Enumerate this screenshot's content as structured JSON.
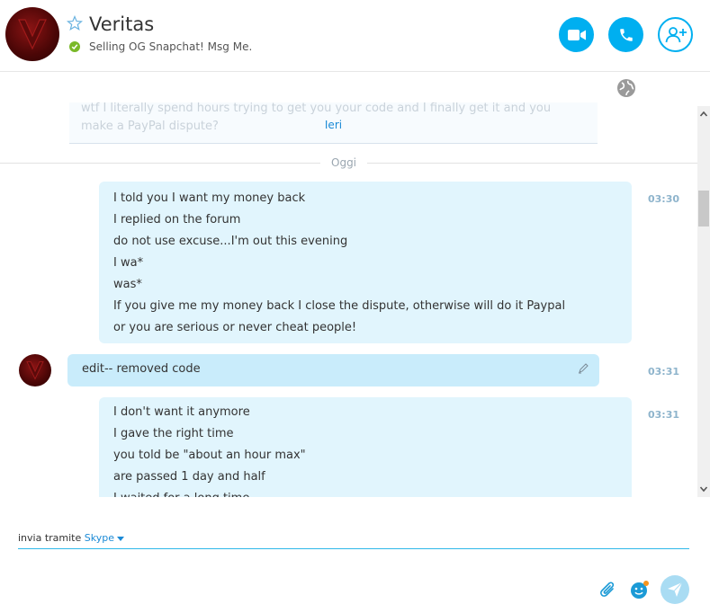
{
  "header": {
    "contact_name": "Veritas",
    "mood_message": "Selling OG Snapchat! Msg Me.",
    "status": "online",
    "buttons": [
      "video-call",
      "audio-call",
      "add-people"
    ]
  },
  "conversation": {
    "yesterday_preview": "wtf I literally spend hours trying to get you your code and I finally get it and you make a PayPal dispute?",
    "yesterday_label": "Ieri",
    "today_label": "Oggi",
    "messages": [
      {
        "sender": "me",
        "time": "03:30",
        "lines": [
          "I told you I want my money back",
          "I replied on the forum",
          "do not use excuse...I'm out this evening",
          "I wa*",
          "was*",
          "If you give me my money back I close the dispute, otherwise will do it Paypal",
          "or you are serious or never cheat people!"
        ]
      },
      {
        "sender": "Veritas",
        "time": "03:31",
        "lines": [
          "edit-- removed code"
        ],
        "edited": true
      },
      {
        "sender": "me",
        "time": "03:31",
        "lines": [
          "I don't want it anymore",
          "I gave the right time",
          "you told be \"about an hour max\"",
          "are passed 1 day and half",
          "I waited for a long time"
        ]
      }
    ]
  },
  "composer": {
    "send_via_label": "invia tramite",
    "send_via_value": "Skype",
    "input_value": ""
  },
  "colors": {
    "accent": "#00aff0",
    "bubble_me": "#e1f5fd",
    "bubble_them": "#c9ecfb",
    "status_online": "#7ab929"
  }
}
